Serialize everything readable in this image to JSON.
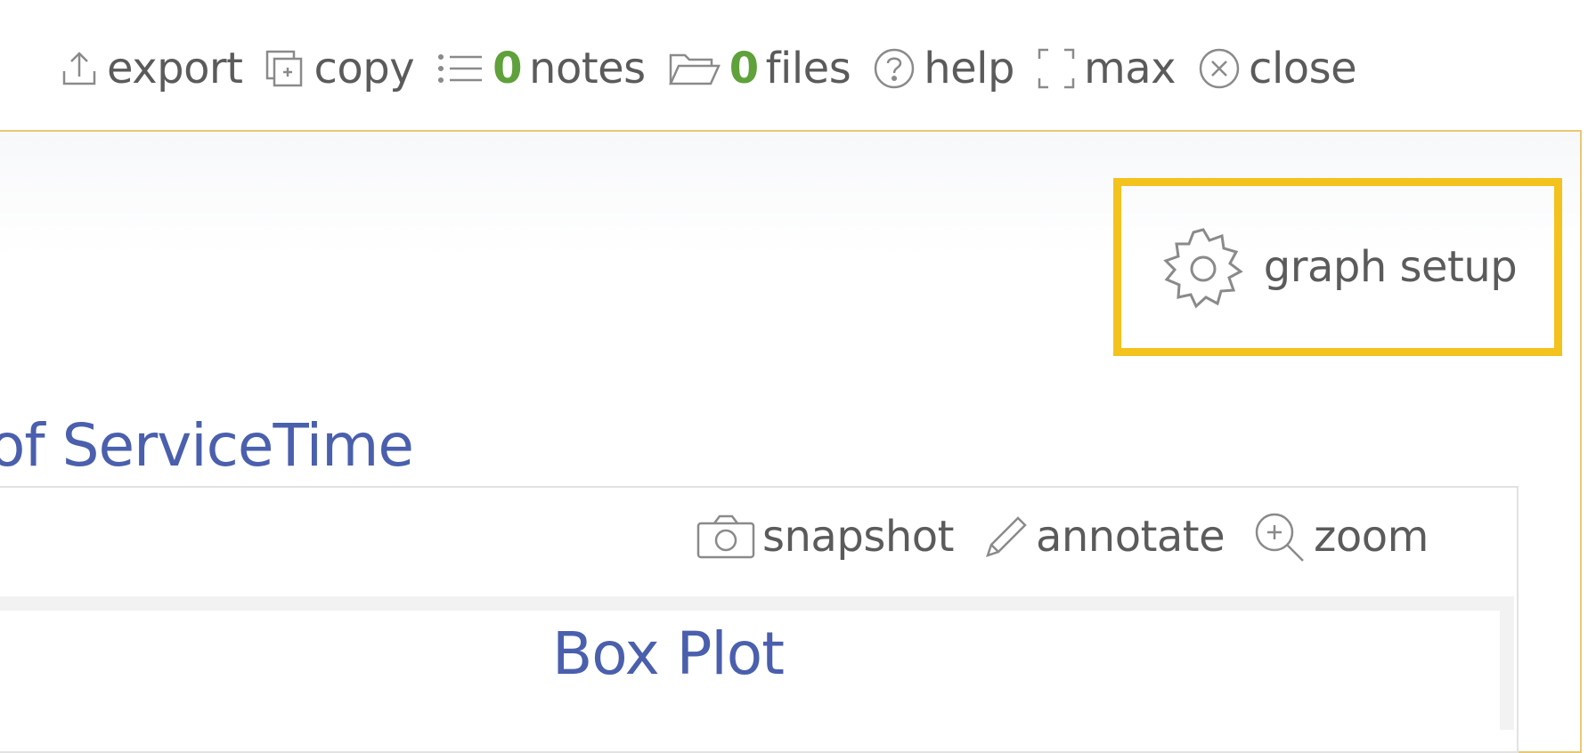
{
  "toolbar": {
    "export_label": "export",
    "copy_label": "copy",
    "notes_count": "0",
    "notes_label": "notes",
    "files_count": "0",
    "files_label": "files",
    "help_label": "help",
    "max_label": "max",
    "close_label": "close"
  },
  "panel": {
    "graph_setup_label": "graph setup",
    "section_title": "of ServiceTime"
  },
  "plot": {
    "snapshot_label": "snapshot",
    "annotate_label": "annotate",
    "zoom_label": "zoom",
    "title": "Box Plot"
  },
  "colors": {
    "accent_highlight": "#f4c21d",
    "title_blue": "#4a5fad",
    "count_green": "#5fa13a",
    "panel_border": "#e9c873"
  },
  "icons": [
    "export-icon",
    "copy-icon",
    "notes-icon",
    "folder-icon",
    "help-icon",
    "maximize-icon",
    "close-icon",
    "gear-icon",
    "camera-icon",
    "pencil-icon",
    "zoom-in-icon"
  ]
}
